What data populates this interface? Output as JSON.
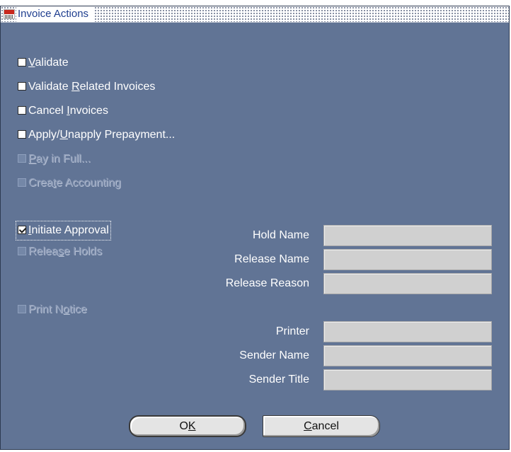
{
  "window": {
    "title": "Invoice Actions"
  },
  "options": [
    {
      "pre": "",
      "key": "V",
      "post": "alidate",
      "checked": false,
      "enabled": true
    },
    {
      "pre": "Validate ",
      "key": "R",
      "post": "elated Invoices",
      "checked": false,
      "enabled": true
    },
    {
      "pre": "Cancel ",
      "key": "I",
      "post": "nvoices",
      "checked": false,
      "enabled": true
    },
    {
      "pre": "Apply/",
      "key": "U",
      "post": "napply Prepayment...",
      "checked": false,
      "enabled": true
    },
    {
      "pre": "",
      "key": "P",
      "post": "ay in Full...",
      "checked": false,
      "enabled": false
    },
    {
      "pre": "Crea",
      "key": "t",
      "post": "e Accounting",
      "checked": false,
      "enabled": false
    },
    {
      "pre": "",
      "key": "I",
      "post": "nitiate Approval",
      "checked": true,
      "enabled": true
    },
    {
      "pre": "Relea",
      "key": "s",
      "post": "e Holds",
      "checked": false,
      "enabled": false
    },
    {
      "pre": "Print N",
      "key": "o",
      "post": "tice",
      "checked": false,
      "enabled": false
    }
  ],
  "fields": {
    "hold_name": {
      "label": "Hold Name",
      "value": ""
    },
    "release_name": {
      "label": "Release Name",
      "value": ""
    },
    "release_reason": {
      "label": "Release Reason",
      "value": ""
    },
    "printer": {
      "label": "Printer",
      "value": ""
    },
    "sender_name": {
      "label": "Sender Name",
      "value": ""
    },
    "sender_title": {
      "label": "Sender Title",
      "value": ""
    }
  },
  "buttons": {
    "ok": {
      "pre": "O",
      "key": "K",
      "post": ""
    },
    "cancel": {
      "pre": "",
      "key": "C",
      "post": "ancel"
    }
  }
}
